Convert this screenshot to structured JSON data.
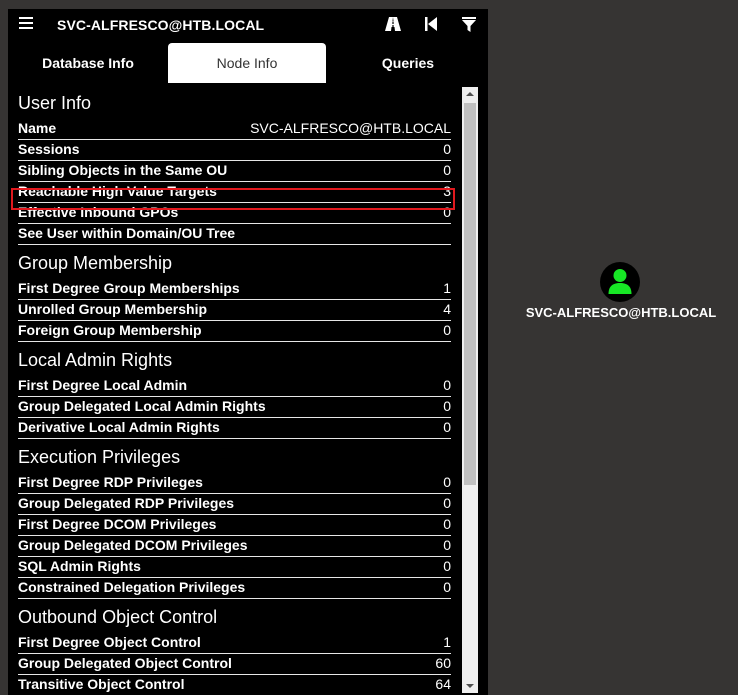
{
  "header": {
    "title": "SVC-ALFRESCO@HTB.LOCAL",
    "icons": [
      "menu-icon",
      "pathfinding-icon",
      "back-icon",
      "filter-icon"
    ]
  },
  "tabs": [
    {
      "label": "Database Info",
      "active": false
    },
    {
      "label": "Node Info",
      "active": true
    },
    {
      "label": "Queries",
      "active": false
    }
  ],
  "sections": [
    {
      "title": "User Info",
      "rows": [
        {
          "label": "Name",
          "value": "SVC-ALFRESCO@HTB.LOCAL"
        },
        {
          "label": "Sessions",
          "value": "0"
        },
        {
          "label": "Sibling Objects in the Same OU",
          "value": "0"
        },
        {
          "label": "Reachable High Value Targets",
          "value": "3"
        },
        {
          "label": "Effective Inbound GPOs",
          "value": "0"
        },
        {
          "label": "See User within Domain/OU Tree",
          "value": ""
        }
      ]
    },
    {
      "title": "Group Membership",
      "rows": [
        {
          "label": "First Degree Group Memberships",
          "value": "1"
        },
        {
          "label": "Unrolled Group Membership",
          "value": "4"
        },
        {
          "label": "Foreign Group Membership",
          "value": "0"
        }
      ]
    },
    {
      "title": "Local Admin Rights",
      "rows": [
        {
          "label": "First Degree Local Admin",
          "value": "0"
        },
        {
          "label": "Group Delegated Local Admin Rights",
          "value": "0"
        },
        {
          "label": "Derivative Local Admin Rights",
          "value": "0"
        }
      ]
    },
    {
      "title": "Execution Privileges",
      "rows": [
        {
          "label": "First Degree RDP Privileges",
          "value": "0"
        },
        {
          "label": "Group Delegated RDP Privileges",
          "value": "0"
        },
        {
          "label": "First Degree DCOM Privileges",
          "value": "0"
        },
        {
          "label": "Group Delegated DCOM Privileges",
          "value": "0"
        },
        {
          "label": "SQL Admin Rights",
          "value": "0"
        },
        {
          "label": "Constrained Delegation Privileges",
          "value": "0"
        }
      ]
    },
    {
      "title": "Outbound Object Control",
      "rows": [
        {
          "label": "First Degree Object Control",
          "value": "1"
        },
        {
          "label": "Group Delegated Object Control",
          "value": "60"
        },
        {
          "label": "Transitive Object Control",
          "value": "64"
        }
      ]
    }
  ],
  "graph_node": {
    "label": "SVC-ALFRESCO@HTB.LOCAL",
    "icon": "user-icon",
    "color": "#17e625"
  },
  "colors": {
    "panel_bg": "#000000",
    "canvas_bg": "#363433",
    "highlight": "#e0191e",
    "node_bg": "#000000",
    "node_icon": "#17e625"
  }
}
